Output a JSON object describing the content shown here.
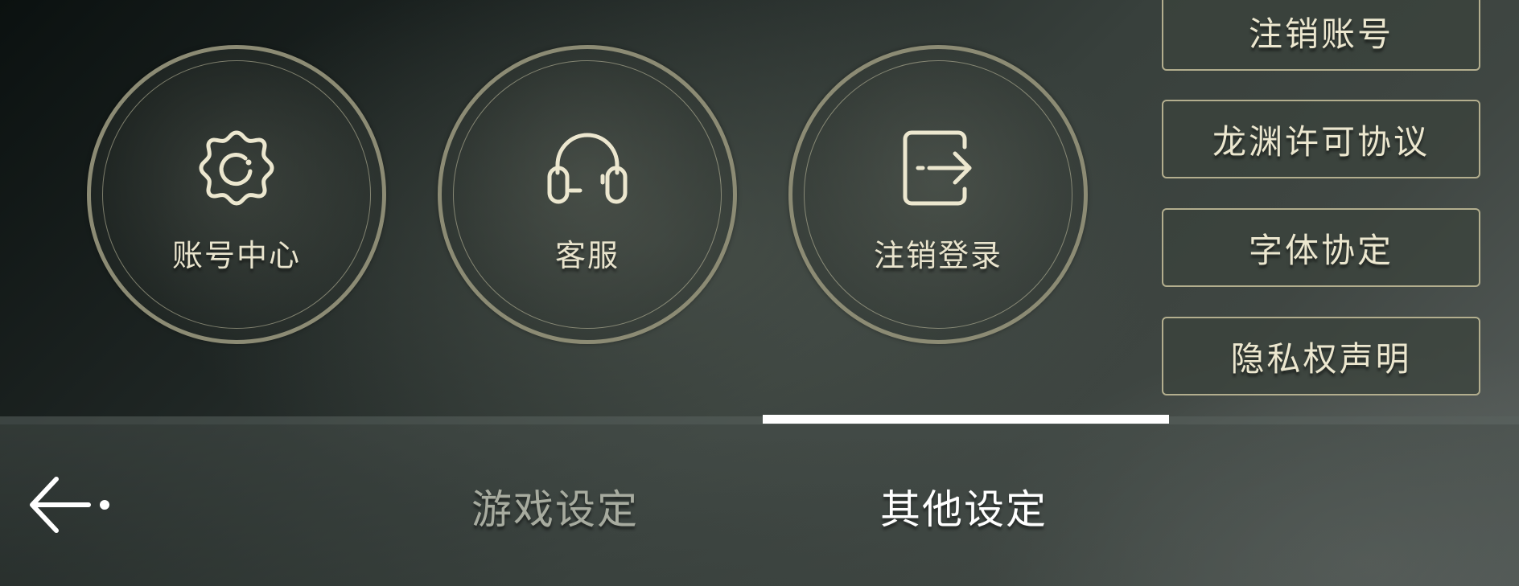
{
  "circle_buttons": [
    {
      "label": "账号中心",
      "icon": "gear-icon"
    },
    {
      "label": "客服",
      "icon": "headset-icon"
    },
    {
      "label": "注销登录",
      "icon": "logout-icon"
    }
  ],
  "side_buttons": [
    {
      "label": "注销账号"
    },
    {
      "label": "龙渊许可协议"
    },
    {
      "label": "字体协定"
    },
    {
      "label": "隐私权声明"
    }
  ],
  "tabs": [
    {
      "label": "游戏设定",
      "active": false
    },
    {
      "label": "其他设定",
      "active": true
    }
  ],
  "back": {
    "icon": "back-arrow-icon"
  },
  "colors": {
    "accent": "#e9e4cd",
    "ring": "#8c8b74",
    "indicator": "#ffffff",
    "inactive_tab": "#a7ab9f"
  }
}
